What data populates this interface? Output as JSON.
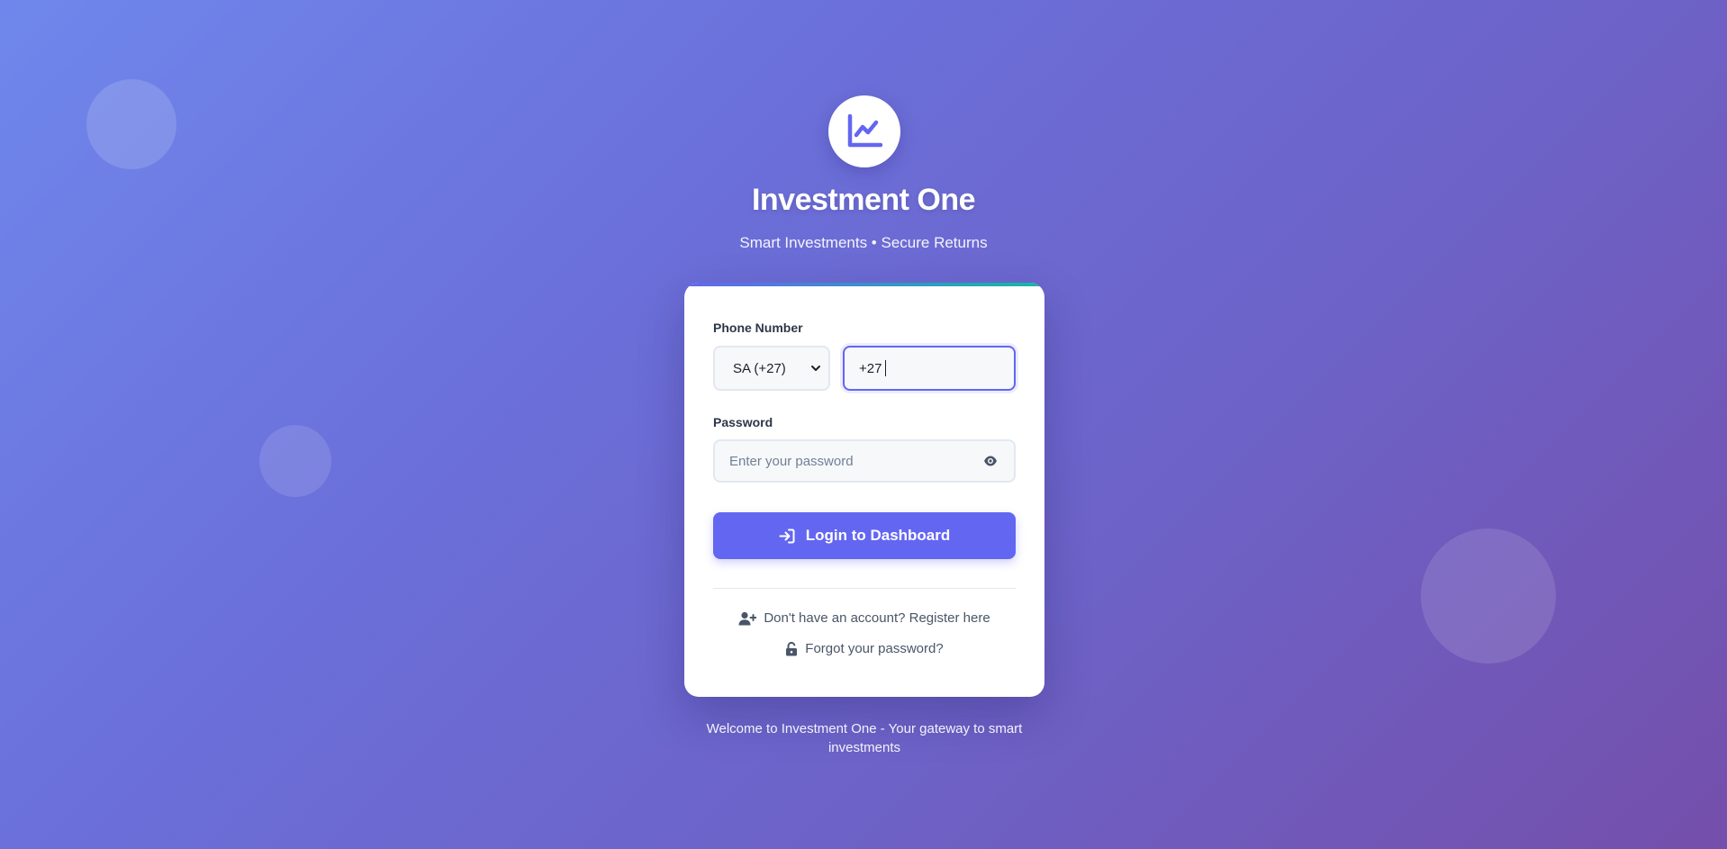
{
  "brand": {
    "title": "Investment One",
    "subtitle": "Smart Investments • Secure Returns",
    "logo_icon": "chart-line-icon"
  },
  "form": {
    "phone_label": "Phone Number",
    "country_selected": "SA (+27)",
    "phone_value": "+27",
    "password_label": "Password",
    "password_placeholder": "Enter your password",
    "login_button": "Login to Dashboard",
    "register_link": "Don't have an account? Register here",
    "forgot_link": "Forgot your password?"
  },
  "footer": {
    "text": "Welcome to Investment One - Your gateway to smart investments"
  },
  "colors": {
    "accent": "#6366f1",
    "accent_secondary": "#14b8a6",
    "bg_start": "#6f87ec",
    "bg_end": "#744fab"
  }
}
